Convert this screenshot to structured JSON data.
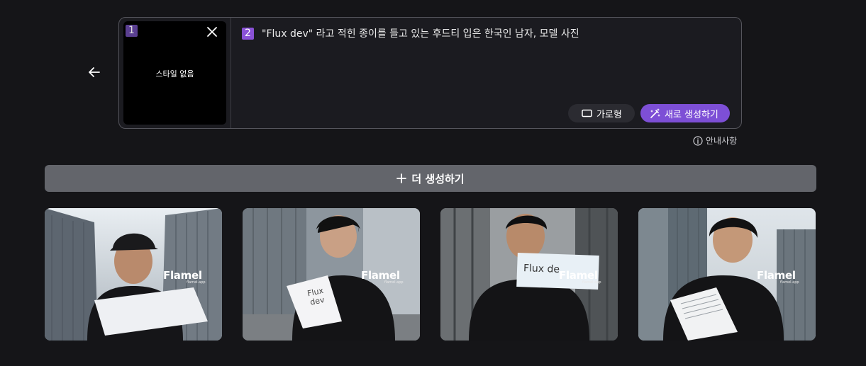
{
  "navigation": {
    "back_icon": "arrow-left-icon"
  },
  "style_panel": {
    "badge": "1",
    "label": "스타일 없음",
    "close_icon": "close-icon"
  },
  "prompt": {
    "badge": "2",
    "text": "\"Flux dev\" 라고 적힌 종이를 들고 있는 후드티 입은 한국인 남자, 모델 사진"
  },
  "actions": {
    "aspect_label": "가로형",
    "aspect_icon": "rectangle-icon",
    "generate_label": "새로 생성하기",
    "generate_icon": "magic-wand-icon",
    "accent_color": "#7d4fd6"
  },
  "guide": {
    "label": "안내사항",
    "icon": "info-icon"
  },
  "more": {
    "label": "더 생성하기",
    "icon": "plus-icon"
  },
  "results": {
    "watermark": "Flamel",
    "watermark_sub": "flamel.app",
    "paper_texts": [
      "Flux dev",
      "Flux de"
    ]
  }
}
